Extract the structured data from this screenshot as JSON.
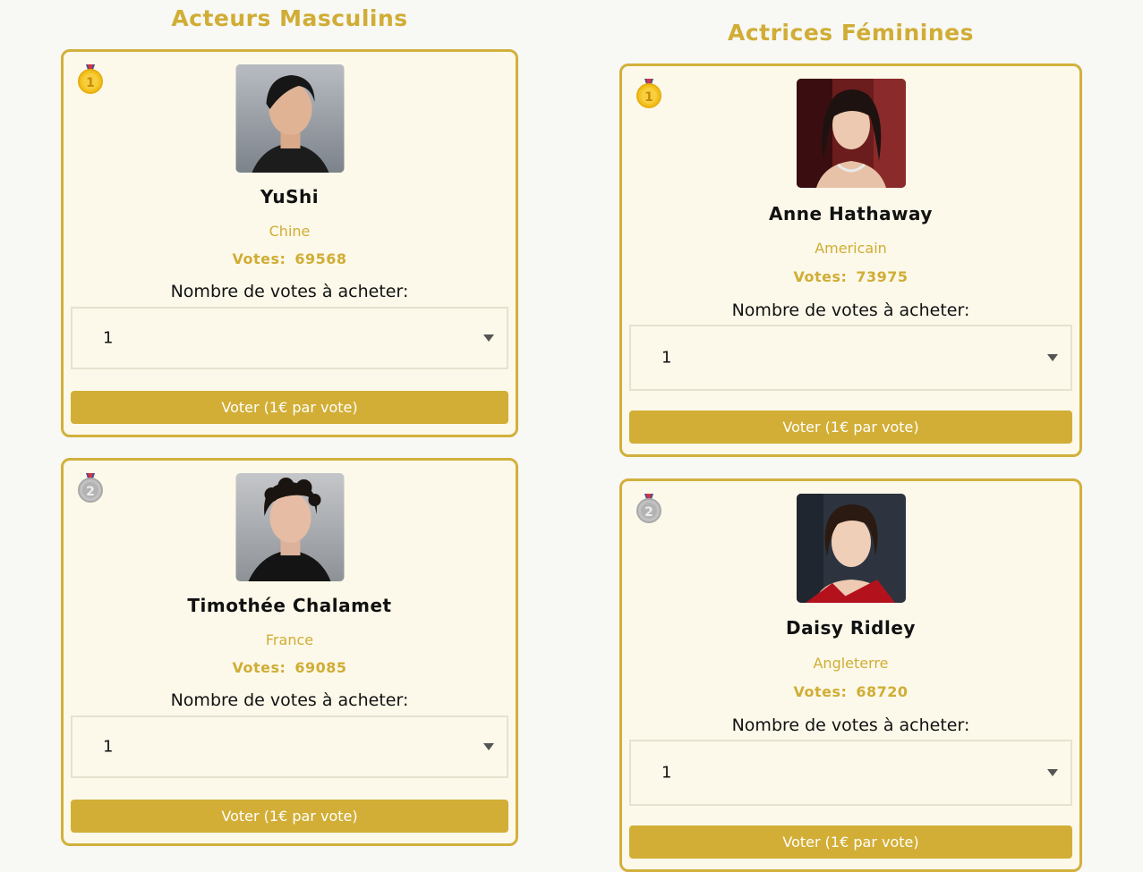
{
  "male": {
    "title": "Acteurs Masculins",
    "cards": [
      {
        "name": "YuShi",
        "country": "Chine",
        "votes_label": "Votes:",
        "votes": "69568",
        "buy_label": "Nombre de votes à acheter:",
        "quantity": "1",
        "button": "Voter (1€ par vote)",
        "medal": "gold-medal-icon",
        "medal_number": "1"
      },
      {
        "name": "Timothée Chalamet",
        "country": "France",
        "votes_label": "Votes:",
        "votes": "69085",
        "buy_label": "Nombre de votes à acheter:",
        "quantity": "1",
        "button": "Voter (1€ par vote)",
        "medal": "silver-medal-icon",
        "medal_number": "2"
      }
    ]
  },
  "female": {
    "title": "Actrices Féminines",
    "cards": [
      {
        "name": "Anne Hathaway",
        "country": "Americain",
        "votes_label": "Votes:",
        "votes": "73975",
        "buy_label": "Nombre de votes à acheter:",
        "quantity": "1",
        "button": "Voter (1€ par vote)",
        "medal": "gold-medal-icon",
        "medal_number": "1"
      },
      {
        "name": "Daisy Ridley",
        "country": "Angleterre",
        "votes_label": "Votes:",
        "votes": "68720",
        "buy_label": "Nombre de votes à acheter:",
        "quantity": "1",
        "button": "Voter (1€ par vote)",
        "medal": "silver-medal-icon",
        "medal_number": "2"
      }
    ]
  },
  "colors": {
    "accent": "#d2ae36",
    "card_bg": "#fcf9ea",
    "gold": "#f3c21e",
    "silver": "#b9b9b9"
  }
}
